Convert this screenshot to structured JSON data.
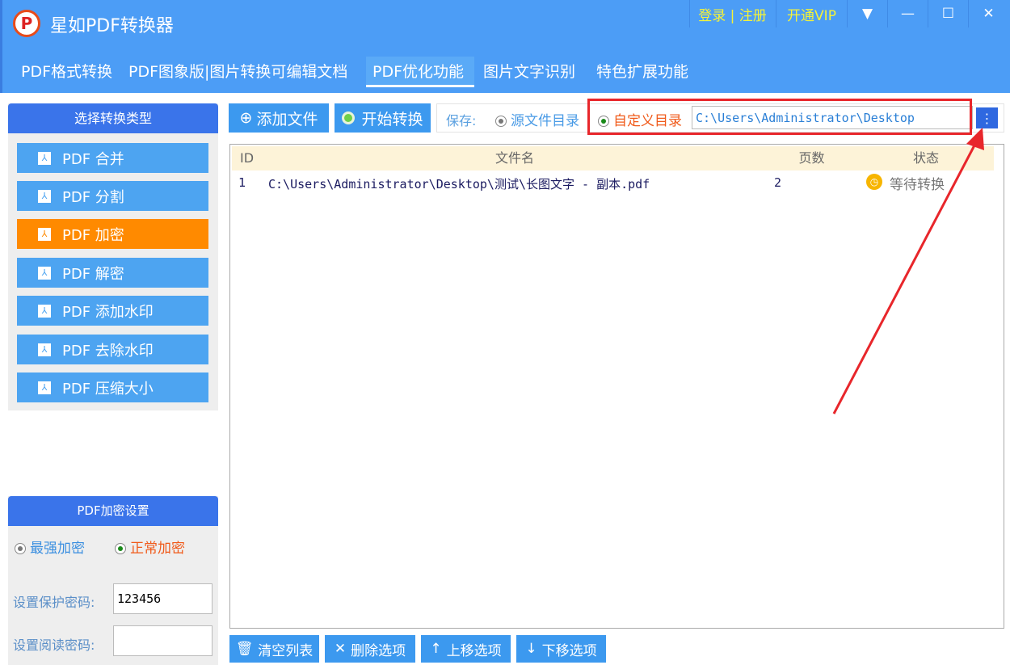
{
  "app": {
    "logo_letter": "P",
    "title": "星如PDF转换器",
    "login": "登录 | 注册",
    "vip": "开通VIP",
    "menu_icon": "▼",
    "min_icon": "—",
    "max_icon": "☐",
    "close_icon": "✕"
  },
  "tabs": [
    {
      "label": "PDF格式转换"
    },
    {
      "label": "PDF图象版|图片转换可编辑文档"
    },
    {
      "label": "PDF优化功能"
    },
    {
      "label": "图片文字识别"
    },
    {
      "label": "特色扩展功能"
    }
  ],
  "sidebar": {
    "title": "选择转换类型",
    "items": [
      {
        "label": "PDF 合并"
      },
      {
        "label": "PDF 分割"
      },
      {
        "label": "PDF 加密"
      },
      {
        "label": "PDF 解密"
      },
      {
        "label": "PDF 添加水印"
      },
      {
        "label": "PDF 去除水印"
      },
      {
        "label": "PDF 压缩大小"
      }
    ]
  },
  "encrypt": {
    "title": "PDF加密设置",
    "opt_strong": "最强加密",
    "opt_normal": "正常加密",
    "protect_label": "设置保护密码:",
    "protect_value": "123456",
    "read_label": "设置阅读密码:",
    "read_value": ""
  },
  "toolbar": {
    "add": "添加文件",
    "start": "开始转换",
    "save_label": "保存:",
    "opt_source": "源文件目录",
    "opt_custom": "自定义目录",
    "path": "C:\\Users\\Administrator\\Desktop",
    "browse": "⋮"
  },
  "table": {
    "headers": [
      "ID",
      "文件名",
      "页数",
      "状态"
    ],
    "rows": [
      {
        "id": "1",
        "file": "C:\\Users\\Administrator\\Desktop\\测试\\长图文字 - 副本.pdf",
        "pages": "2",
        "status": "等待转换"
      }
    ]
  },
  "bottom": {
    "clear": "清空列表",
    "delete": "删除选项",
    "up": "上移选项",
    "down": "下移选项"
  }
}
